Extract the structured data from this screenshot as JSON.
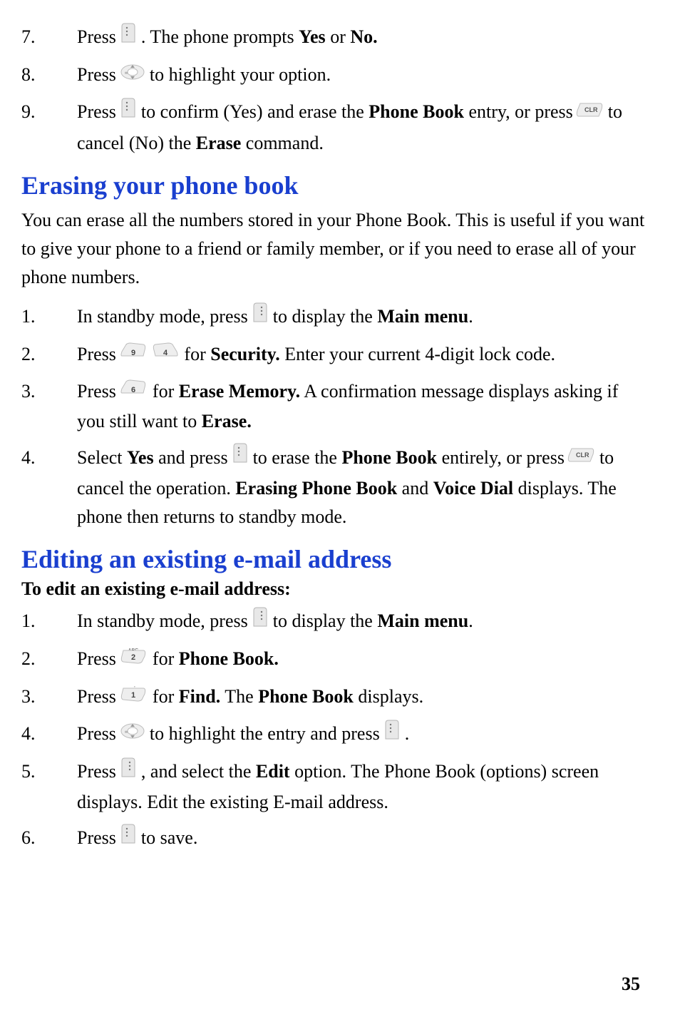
{
  "topList": {
    "items": [
      {
        "num": "7.",
        "parts": [
          {
            "t": "Press  "
          },
          {
            "icon": "soft-right-icon"
          },
          {
            "t": " . The phone prompts "
          },
          {
            "b": "Yes"
          },
          {
            "t": " or "
          },
          {
            "b": "No."
          }
        ]
      },
      {
        "num": "8.",
        "parts": [
          {
            "t": "Press "
          },
          {
            "icon": "nav-icon"
          },
          {
            "t": " to highlight your option."
          }
        ]
      },
      {
        "num": "9.",
        "parts": [
          {
            "t": "Press  "
          },
          {
            "icon": "soft-right-icon"
          },
          {
            "t": "  to confirm (Yes) and erase the "
          },
          {
            "b": "Phone Book"
          },
          {
            "t": " entry, or press "
          },
          {
            "icon": "clr-key-icon"
          },
          {
            "t": " to cancel (No) the "
          },
          {
            "b": "Erase"
          },
          {
            "t": " command."
          }
        ]
      }
    ]
  },
  "heading1": "Erasing your phone book",
  "para1": "You can erase all the numbers stored in your Phone Book. This is useful if you want to give your phone to a friend or family member, or if you need to erase all of your phone numbers.",
  "eraseList": {
    "items": [
      {
        "num": "1.",
        "parts": [
          {
            "t": "In standby mode, press "
          },
          {
            "icon": "soft-left-icon"
          },
          {
            "t": "  to display the "
          },
          {
            "b": "Main menu"
          },
          {
            "t": "."
          }
        ]
      },
      {
        "num": "2.",
        "parts": [
          {
            "t": "Press "
          },
          {
            "icon": "key9-icon"
          },
          {
            "t": "   "
          },
          {
            "icon": "key4-icon"
          },
          {
            "t": " for "
          },
          {
            "b": "Security."
          },
          {
            "t": " Enter your current 4-digit lock code."
          }
        ]
      },
      {
        "num": "3.",
        "parts": [
          {
            "t": "Press "
          },
          {
            "icon": "key6-icon"
          },
          {
            "t": " for "
          },
          {
            "b": "Erase Memory."
          },
          {
            "t": " A confirmation message displays asking if you still want to "
          },
          {
            "b": "Erase."
          }
        ]
      },
      {
        "num": "4.",
        "parts": [
          {
            "t": "Select "
          },
          {
            "b": "Yes"
          },
          {
            "t": " and press  "
          },
          {
            "icon": "soft-right-icon"
          },
          {
            "t": "  to erase the "
          },
          {
            "b": "Phone Book"
          },
          {
            "t": " entirely, or press "
          },
          {
            "icon": "clr-key-icon"
          },
          {
            "t": " to cancel the operation. "
          },
          {
            "b": "Erasing Phone Book"
          },
          {
            "t": " and "
          },
          {
            "b": "Voice Dial"
          },
          {
            "t": " displays. The phone then returns to standby mode."
          }
        ]
      }
    ]
  },
  "heading2": "Editing an existing e-mail address",
  "subhead": "To edit an existing e-mail address:",
  "editList": {
    "items": [
      {
        "num": "1.",
        "parts": [
          {
            "t": "In standby mode, press "
          },
          {
            "icon": "soft-left-icon"
          },
          {
            "t": "   to display the "
          },
          {
            "b": "Main menu"
          },
          {
            "t": "."
          }
        ]
      },
      {
        "num": "2.",
        "parts": [
          {
            "t": "Press "
          },
          {
            "icon": "key2-icon"
          },
          {
            "t": " for "
          },
          {
            "b": "Phone Book."
          }
        ]
      },
      {
        "num": "3.",
        "parts": [
          {
            "t": "Press "
          },
          {
            "icon": "key1-icon"
          },
          {
            "t": " for "
          },
          {
            "b": "Find."
          },
          {
            "t": " The "
          },
          {
            "b": "Phone Book"
          },
          {
            "t": " displays."
          }
        ]
      },
      {
        "num": "4.",
        "parts": [
          {
            "t": "Press "
          },
          {
            "icon": "nav-icon"
          },
          {
            "t": " to highlight the entry and press   "
          },
          {
            "icon": "soft-right-icon"
          },
          {
            "t": "  ."
          }
        ]
      },
      {
        "num": "5.",
        "parts": [
          {
            "t": "Press "
          },
          {
            "icon": "soft-left-icon"
          },
          {
            "t": "   , and select the "
          },
          {
            "b": "Edit"
          },
          {
            "t": " option. The Phone Book (options) screen displays. Edit the existing E-mail address."
          }
        ]
      },
      {
        "num": "6.",
        "parts": [
          {
            "t": "Press  "
          },
          {
            "icon": "soft-right-icon"
          },
          {
            "t": "  to save."
          }
        ]
      }
    ]
  },
  "pageNumber": "35"
}
